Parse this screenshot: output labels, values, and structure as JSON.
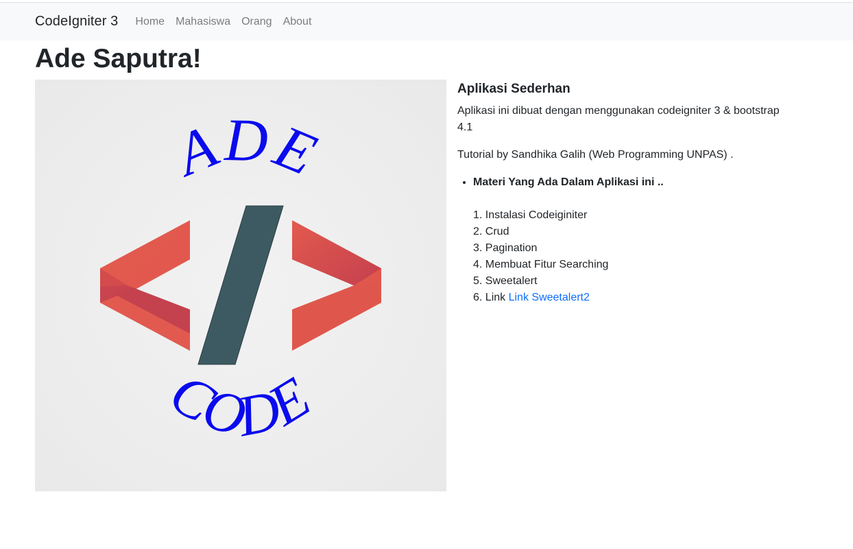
{
  "navbar": {
    "brand": "CodeIgniter 3",
    "links": [
      "Home",
      "Mahasiswa",
      "Orang",
      "About"
    ]
  },
  "page": {
    "title": "Ade Saputra!"
  },
  "logo": {
    "top_text": "ADE",
    "bottom_text": "CODE",
    "slash": "/",
    "colors": {
      "text": "#0a0aee",
      "brackets": "#e15a4e",
      "brackets_shadow": "#c2414d",
      "slash": "#3d5a62"
    }
  },
  "content": {
    "title": "Aplikasi Sederhan",
    "description": "Aplikasi ini dibuat dengan menggunakan codeigniter 3 & bootstrap 4.1",
    "tutorial": "Tutorial by Sandhika Galih (Web Programming UNPAS) .",
    "materi_heading": "Materi Yang Ada Dalam Aplikasi ini ..",
    "items": [
      "1. Instalasi Codeiginiter",
      "2. Crud",
      "3. Pagination",
      "4. Membuat Fitur Searching",
      "5. Sweetalert",
      "6. Link "
    ],
    "link_text": "Link Sweetalert2"
  },
  "colors": {
    "navbar_bg": "#f8f9fa",
    "link": "#0d6efd",
    "muted_nav": "#7a7d80"
  }
}
